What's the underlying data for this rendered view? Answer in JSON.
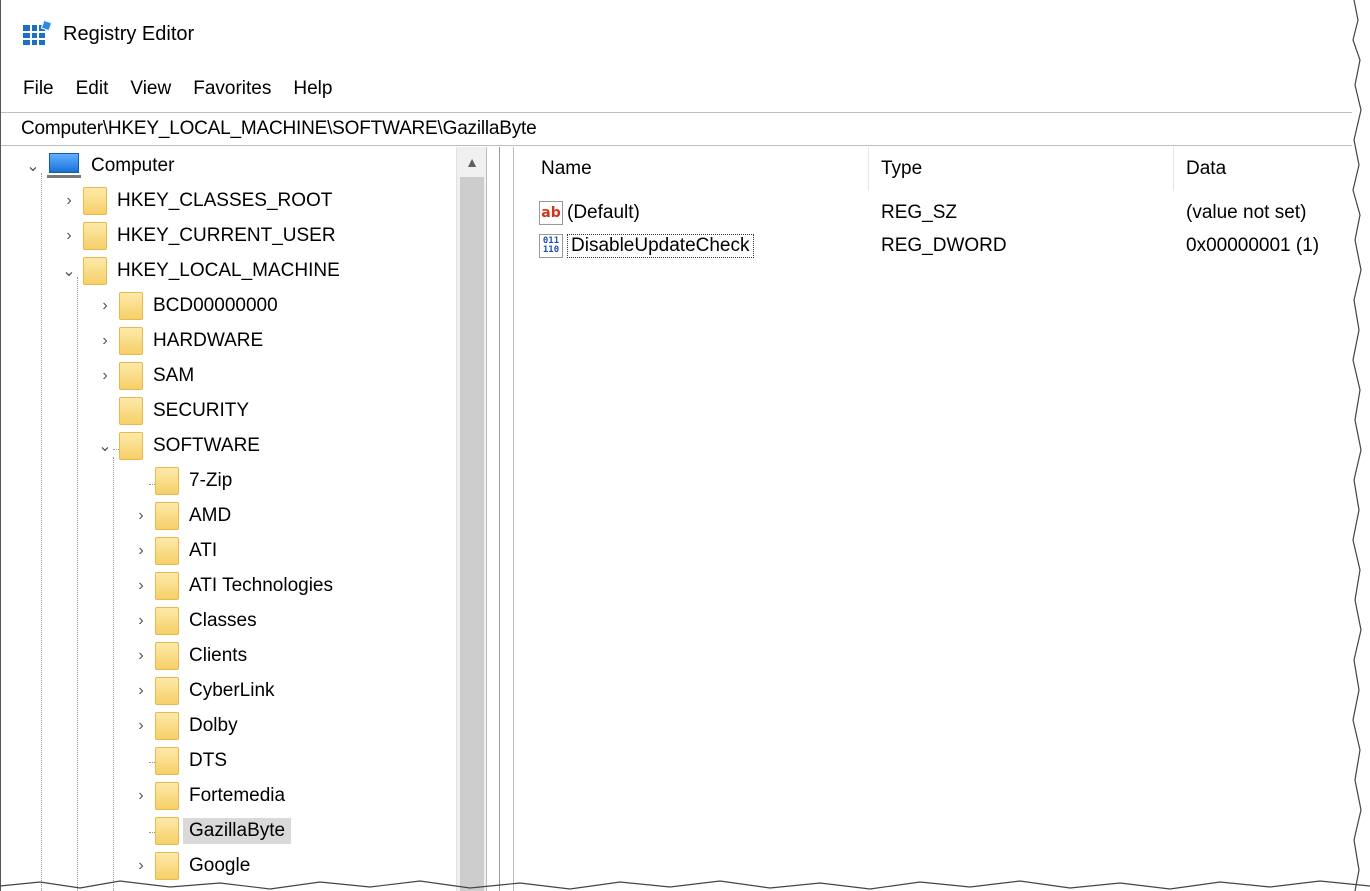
{
  "window": {
    "title": "Registry Editor",
    "icon": "registry-editor-icon"
  },
  "menu": [
    "File",
    "Edit",
    "View",
    "Favorites",
    "Help"
  ],
  "address": "Computer\\HKEY_LOCAL_MACHINE\\SOFTWARE\\GazillaByte",
  "tree": {
    "root": "Computer",
    "hives": [
      "HKEY_CLASSES_ROOT",
      "HKEY_CURRENT_USER",
      "HKEY_LOCAL_MACHINE"
    ],
    "hklm_children": [
      "BCD00000000",
      "HARDWARE",
      "SAM",
      "SECURITY",
      "SOFTWARE"
    ],
    "software_children": [
      "7-Zip",
      "AMD",
      "ATI",
      "ATI Technologies",
      "Classes",
      "Clients",
      "CyberLink",
      "Dolby",
      "DTS",
      "Fortemedia",
      "GazillaByte",
      "Google"
    ],
    "selected": "GazillaByte"
  },
  "list": {
    "headers": {
      "name": "Name",
      "type": "Type",
      "data": "Data"
    },
    "rows": [
      {
        "icon": "string-value-icon",
        "icon_text": "ab",
        "name": "(Default)",
        "type": "REG_SZ",
        "data": "(value not set)"
      },
      {
        "icon": "dword-value-icon",
        "icon_text": "011\n110",
        "name": "DisableUpdateCheck",
        "type": "REG_DWORD",
        "data": "0x00000001 (1)"
      }
    ]
  },
  "colors": {
    "selection": "#d9d9d9",
    "folder": "#f6d068",
    "string_icon": "#d0341f",
    "dword_icon": "#1c4fb5"
  }
}
